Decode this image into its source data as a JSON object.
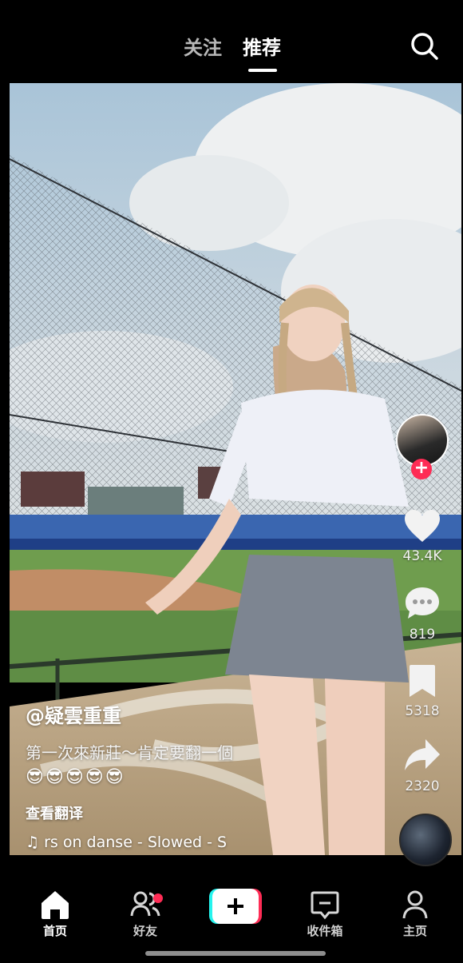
{
  "top_nav": {
    "tabs": [
      {
        "label": "关注",
        "active": false
      },
      {
        "label": "推荐",
        "active": true
      }
    ],
    "search_icon": "search-icon"
  },
  "video": {
    "author": "@疑雲重重",
    "caption": "第一次來新莊～肯定要翻一個",
    "emojis": "😎😎😎😎😎",
    "translate_label": "查看翻译",
    "music_note_icon": "music-note-icon",
    "music": "rs on danse - Slowed - S"
  },
  "actions": {
    "like_count": "43.4K",
    "comment_count": "819",
    "favorite_count": "5318",
    "share_count": "2320",
    "follow_symbol": "+"
  },
  "bottom_nav": {
    "items": [
      {
        "label": "首页",
        "icon": "home-icon",
        "active": true
      },
      {
        "label": "好友",
        "icon": "friends-icon",
        "active": false,
        "notification_dot": true
      },
      {
        "label": "",
        "icon": "create-plus-icon",
        "active": false
      },
      {
        "label": "收件箱",
        "icon": "inbox-icon",
        "active": false
      },
      {
        "label": "主页",
        "icon": "profile-icon",
        "active": false
      }
    ]
  },
  "colors": {
    "accent": "#fe2c55",
    "cyan": "#25f4ee",
    "background": "#000000"
  }
}
